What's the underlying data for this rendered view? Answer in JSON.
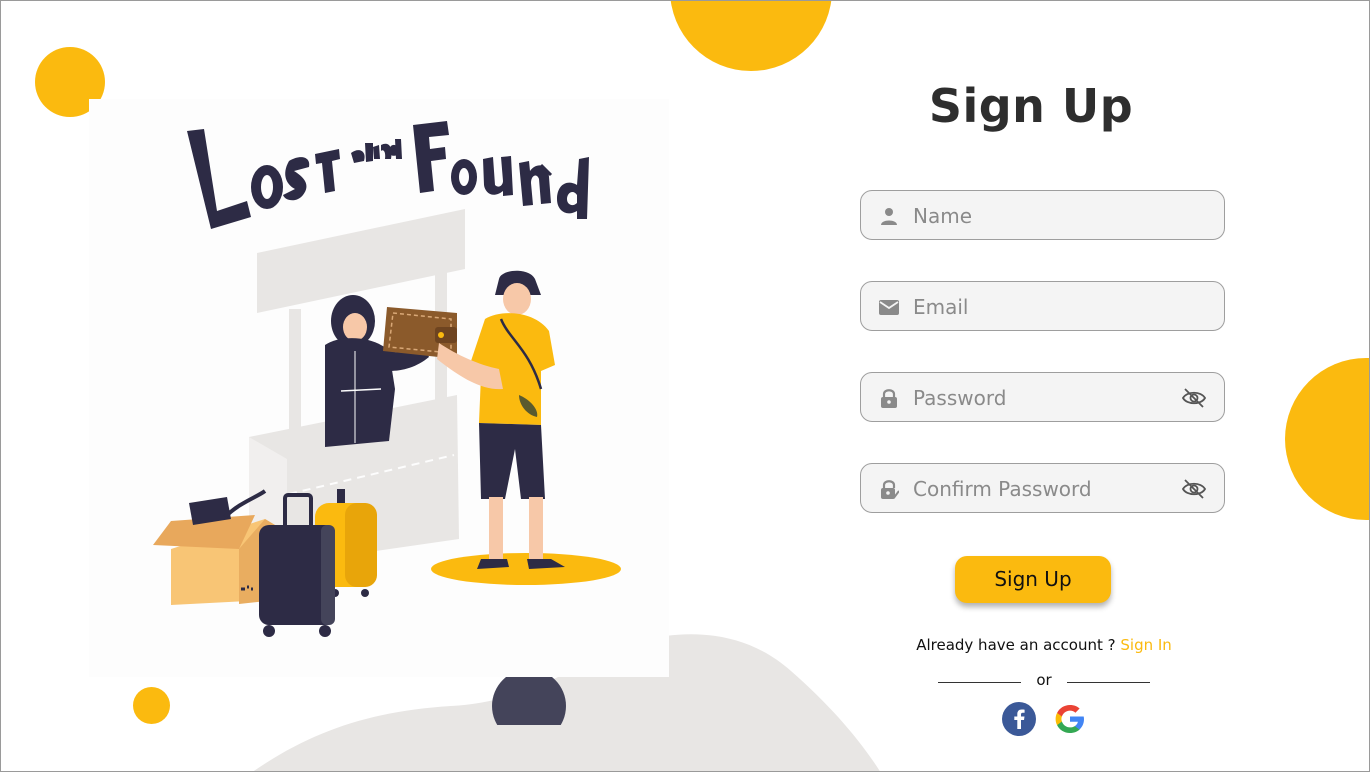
{
  "title": "Sign Up",
  "fields": {
    "name": {
      "placeholder": "Name",
      "icon": "person-icon"
    },
    "email": {
      "placeholder": "Email",
      "icon": "mail-icon"
    },
    "password": {
      "placeholder": "Password",
      "icon": "lock-icon"
    },
    "confirm": {
      "placeholder": "Confirm Password",
      "icon": "lock-check-icon"
    }
  },
  "button": {
    "label": "Sign Up"
  },
  "signin": {
    "prompt": "Already have an account ?",
    "link": "Sign In"
  },
  "divider": {
    "text": "or"
  },
  "social": [
    "facebook-icon",
    "google-icon"
  ],
  "illustration": {
    "title_line1": "Lost",
    "title_and": "and",
    "title_line2": "Found"
  },
  "colors": {
    "accent": "#fbba0f",
    "text": "#2e2e2e",
    "field_bg": "#f4f4f4",
    "blob": "#e8e6e4",
    "navy": "#2d2b45"
  }
}
